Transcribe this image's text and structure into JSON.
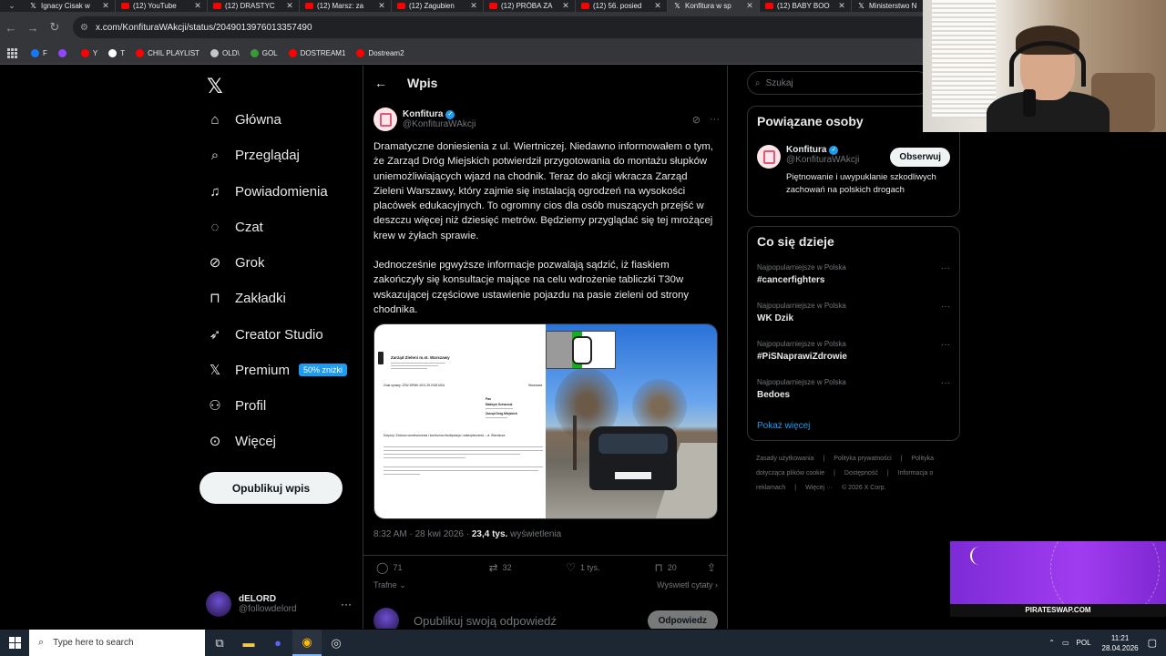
{
  "browser": {
    "tabs": [
      {
        "label": "Ignacy Cisak w",
        "icon": "x-icon",
        "active": false
      },
      {
        "label": "(12) YouTube",
        "icon": "youtube-icon",
        "active": false
      },
      {
        "label": "(12) DRASTYC",
        "icon": "youtube-icon",
        "active": false
      },
      {
        "label": "(12) Marsz: za",
        "icon": "youtube-icon",
        "active": false
      },
      {
        "label": "(12) Zagubien",
        "icon": "youtube-icon",
        "active": false
      },
      {
        "label": "(12) PRÓBA ZA",
        "icon": "youtube-icon",
        "active": false
      },
      {
        "label": "(12) 56. posied",
        "icon": "youtube-icon",
        "active": false
      },
      {
        "label": "Konfitura w sp",
        "icon": "x-icon",
        "active": true
      },
      {
        "label": "(12) BABY BOO",
        "icon": "youtube-icon",
        "active": false
      },
      {
        "label": "Ministerstwo N",
        "icon": "x-icon",
        "active": false
      }
    ],
    "url": "x.com/KonfituraWAkcji/status/2049013976013357490",
    "bookmarks": [
      {
        "label": "F",
        "color": "#1877f2"
      },
      {
        "label": "",
        "color": "#9146ff"
      },
      {
        "label": "Y",
        "color": "#ff0000"
      },
      {
        "label": "T",
        "color": "#ffffff"
      },
      {
        "label": "CHIL PLAYLIST",
        "color": "#ff0000"
      },
      {
        "label": "OLD\\",
        "color": "#c4c7c5"
      },
      {
        "label": "GOL",
        "color": "#3a9a3a"
      },
      {
        "label": "DOSTREAM1",
        "color": "#ff0000"
      },
      {
        "label": "Dostream2",
        "color": "#ff0000"
      }
    ]
  },
  "nav": {
    "items": [
      {
        "label": "Główna",
        "icon": "home-icon"
      },
      {
        "label": "Przeglądaj",
        "icon": "search-icon"
      },
      {
        "label": "Powiadomienia",
        "icon": "bell-icon"
      },
      {
        "label": "Czat",
        "icon": "chat-icon"
      },
      {
        "label": "Grok",
        "icon": "grok-icon"
      },
      {
        "label": "Zakładki",
        "icon": "bookmark-icon"
      },
      {
        "label": "Creator Studio",
        "icon": "rocket-icon"
      },
      {
        "label": "Premium",
        "icon": "x-icon"
      },
      {
        "label": "Profil",
        "icon": "person-icon"
      },
      {
        "label": "Więcej",
        "icon": "more-icon"
      }
    ],
    "premium_badge": "50% zniżki",
    "publish": "Opublikuj wpis",
    "me": {
      "name": "dELORD",
      "handle": "@followdelord"
    }
  },
  "post": {
    "header": "Wpis",
    "author_name": "Konfitura",
    "author_handle": "@KonfituraWAkcji",
    "paragraph1": "Dramatyczne doniesienia z ul. Wiertniczej. Niedawno informowałem o tym, że Zarząd Dróg Miejskich potwierdził przygotowania do montażu słupków uniemożliwiających wjazd na chodnik. Teraz do akcji wkracza Zarząd Zieleni Warszawy, który zajmie się instalacją ogrodzeń na wysokości placówek edukacyjnych. To ogromny cios dla osób muszących przejść w deszczu więcej niż dziesięć metrów. Będziemy przyglądać się tej mrożącej krew w żyłach sprawie.",
    "paragraph2": "Jednocześnie pgwyższe informacje pozwalają sądzić, iż fiaskiem zakończyły się konsultacje mające na celu wdrożenie tabliczki T30w wskazującej częściowe ustawienie pojazdu na pasie zieleni od strony chodnika.",
    "time": "8:32 AM · 28 kwi 2026 · ",
    "views": "23,4 tys.",
    "views_label": " wyświetlenia",
    "stats": {
      "replies": "71",
      "reposts": "32",
      "likes": "1 tys.",
      "bookmarks": "20"
    },
    "sort": "Trafne",
    "quotes": "Wyświetl cytaty",
    "reply_placeholder": "Opublikuj swoją odpowiedź",
    "reply_button": "Odpowiedz",
    "doc": {
      "org": "Zarząd Zieleni m.st. Warszawy",
      "sign": "Znak sprawy: ZZW-DRMK.4011.25.2026.MZA",
      "city": "Warszawa",
      "to": "Pan",
      "to_name": "Maksym Szewczuk",
      "to_cc": "Zarząd Dróg Miejskich",
      "subject": "Dotyczy: Zmiana rozmieszczenia i konieczna rekultywacja i zabezpieczenia – ul. Wiertnicza"
    }
  },
  "right": {
    "search_placeholder": "Szukaj",
    "related_title": "Powiązane osoby",
    "person": {
      "name": "Konfitura",
      "handle": "@KonfituraWAkcji",
      "follow": "Obserwuj",
      "bio": "Piętnowanie i uwypuklanie szkodliwych zachowań na polskich drogach"
    },
    "trending_title": "Co się dzieje",
    "trends": [
      {
        "category": "Najpopularniejsze w Polska",
        "name": "#cancerfighters"
      },
      {
        "category": "Najpopularniejsze w Polska",
        "name": "WK Dzik"
      },
      {
        "category": "Najpopularniejsze w Polska",
        "name": "#PiSNaprawiZdrowie"
      },
      {
        "category": "Najpopularniejsze w Polska",
        "name": "Bedoes"
      }
    ],
    "show_more": "Pokaż więcej",
    "footer": [
      "Zasady użytkowania",
      "|",
      "Polityka prywatności",
      "|",
      "Polityka dotycząca plików cookie",
      "|",
      "Dostępność",
      "|",
      "Informacja o reklamach",
      "|",
      "Więcej ···",
      "© 2026 X Corp."
    ]
  },
  "overlay": {
    "brand": "PIRATESWAP.COM"
  },
  "taskbar": {
    "search_placeholder": "Type here to search",
    "lang": "POL",
    "time": "11:21",
    "date": "28.04.2026"
  }
}
